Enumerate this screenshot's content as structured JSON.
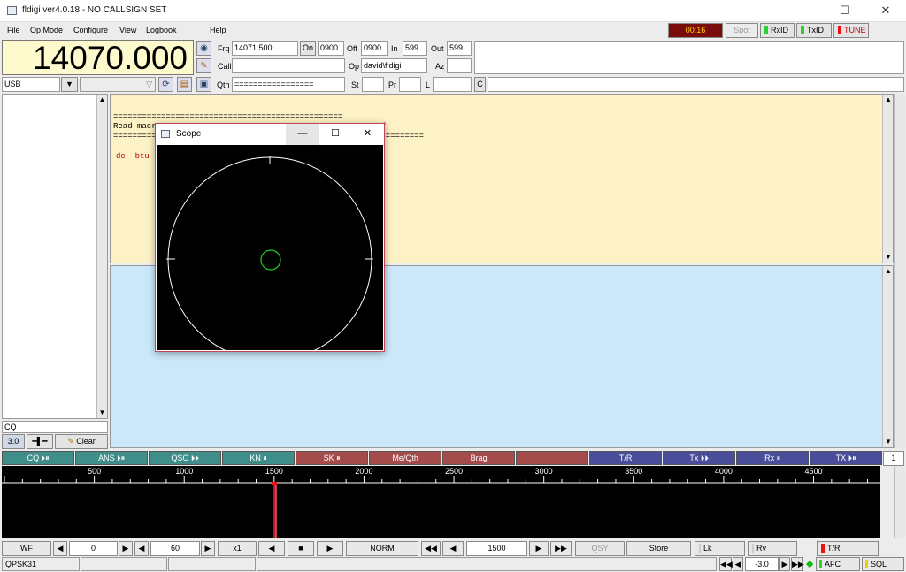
{
  "window": {
    "title": "fldigi ver4.0.18 - NO CALLSIGN SET",
    "min": "—",
    "max": "☐",
    "close": "✕"
  },
  "menu": {
    "file": "File",
    "opmode": "Op Mode",
    "configure": "Configure",
    "view": "View",
    "logbook": "Logbook",
    "help": "Help"
  },
  "status_top": {
    "timer": "00:16",
    "spot": "Spot",
    "rxid": "RxID",
    "txid": "TxID",
    "tune": "TUNE"
  },
  "freq_display": "14070.000",
  "mode_select": "USB",
  "log": {
    "frq_label": "Frq",
    "frq": "14071.500",
    "on_label": "On",
    "on": "0900",
    "off_label": "Off",
    "off": "0900",
    "in_label": "In",
    "in": "599",
    "out_label": "Out",
    "out": "599",
    "call_label": "Call",
    "call": "",
    "op_label": "Op",
    "op": "david\\fldigi",
    "az_label": "Az",
    "az": "",
    "qth_label": "Qth",
    "qth": "=================",
    "st_label": "St",
    "st": "",
    "pr_label": "Pr",
    "pr": "",
    "l_label": "L",
    "l": "",
    "c_label": "C"
  },
  "left": {
    "cq": "CQ",
    "squelch": "3.0",
    "clear": "Clear"
  },
  "rx_text": {
    "line1": "================================================",
    "line2": "Read macr",
    "line2b": "f",
    "line3": "=========",
    "line3b": "==========",
    "red": "de  btu c"
  },
  "macros": [
    {
      "label": "CQ ⏵⏸",
      "color": "#3f8e8a"
    },
    {
      "label": "ANS ⏵⏸",
      "color": "#3f8e8a"
    },
    {
      "label": "QSO ⏵⏵",
      "color": "#3f8e8a"
    },
    {
      "label": "KN ⏸",
      "color": "#3f8e8a"
    },
    {
      "label": "SK ⏸",
      "color": "#a44c4c"
    },
    {
      "label": "Me/Qth",
      "color": "#a44c4c"
    },
    {
      "label": "Brag",
      "color": "#a44c4c"
    },
    {
      "label": "",
      "color": "#a44c4c"
    },
    {
      "label": "T/R",
      "color": "#4a4e9a"
    },
    {
      "label": "Tx ⏵⏵",
      "color": "#4a4e9a"
    },
    {
      "label": "Rx ⏸",
      "color": "#4a4e9a"
    },
    {
      "label": "TX ⏵⏸",
      "color": "#4a4e9a"
    }
  ],
  "macro_page": "1",
  "scale_ticks": [
    "500",
    "1000",
    "1500",
    "2000",
    "2500",
    "3000",
    "3500",
    "4000",
    "4500"
  ],
  "waterfall": {
    "wf_btn": "WF",
    "offset": "0",
    "rate": "60",
    "zoom": "x1",
    "mode": "NORM",
    "freq": "1500",
    "qsy": "QSY",
    "store": "Store",
    "lk": "Lk",
    "rv": "Rv",
    "tr": "T/R"
  },
  "statusbar": {
    "mode": "QPSK31",
    "afc_val": "-3.0",
    "afc": "AFC",
    "sql": "SQL"
  },
  "scope": {
    "title": "Scope",
    "min": "—",
    "max": "☐",
    "close": "✕"
  }
}
